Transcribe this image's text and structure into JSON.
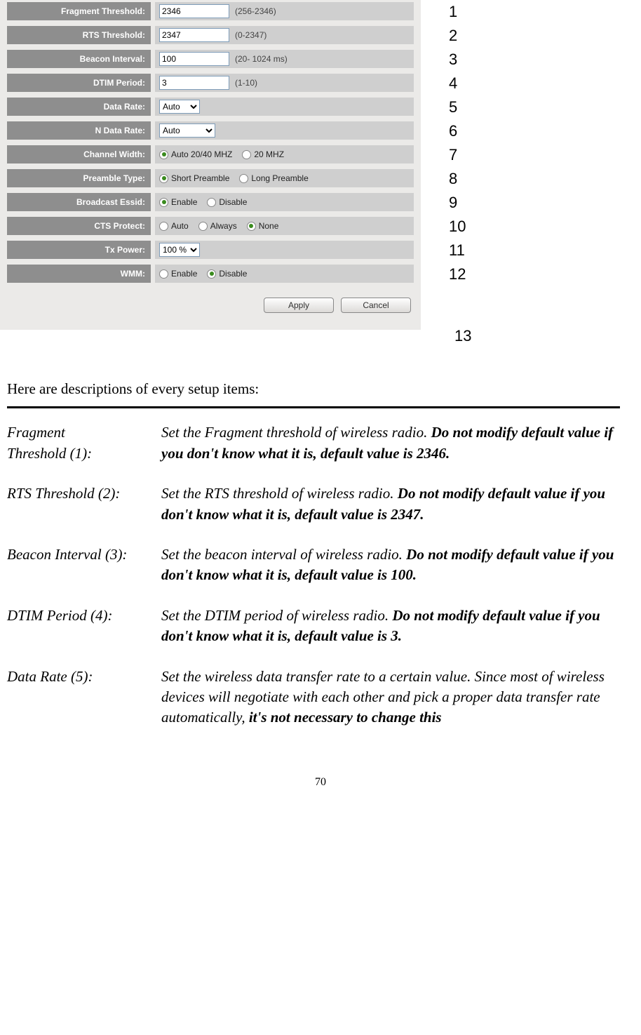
{
  "form": {
    "rows": [
      {
        "label": "Fragment Threshold:",
        "type": "text",
        "value": "2346",
        "hint": "(256-2346)",
        "num": "1"
      },
      {
        "label": "RTS Threshold:",
        "type": "text",
        "value": "2347",
        "hint": "(0-2347)",
        "num": "2"
      },
      {
        "label": "Beacon Interval:",
        "type": "text",
        "value": "100",
        "hint": "(20- 1024 ms)",
        "num": "3"
      },
      {
        "label": "DTIM Period:",
        "type": "text",
        "value": "3",
        "hint": "(1-10)",
        "num": "4"
      },
      {
        "label": "Data Rate:",
        "type": "select",
        "value": "Auto",
        "num": "5"
      },
      {
        "label": "N Data Rate:",
        "type": "select",
        "value": "Auto",
        "num": "6",
        "wide": true
      },
      {
        "label": "Channel Width:",
        "type": "radio",
        "options": [
          {
            "label": "Auto 20/40 MHZ",
            "checked": true
          },
          {
            "label": "20 MHZ",
            "checked": false
          }
        ],
        "num": "7"
      },
      {
        "label": "Preamble Type:",
        "type": "radio",
        "options": [
          {
            "label": "Short Preamble",
            "checked": true
          },
          {
            "label": "Long Preamble",
            "checked": false
          }
        ],
        "num": "8"
      },
      {
        "label": "Broadcast Essid:",
        "type": "radio",
        "options": [
          {
            "label": "Enable",
            "checked": true
          },
          {
            "label": "Disable",
            "checked": false
          }
        ],
        "num": "9"
      },
      {
        "label": "CTS Protect:",
        "type": "radio",
        "options": [
          {
            "label": "Auto",
            "checked": false
          },
          {
            "label": "Always",
            "checked": false
          },
          {
            "label": "None",
            "checked": true
          }
        ],
        "num": "10"
      },
      {
        "label": "Tx Power:",
        "type": "select",
        "value": "100 %",
        "num": "11"
      },
      {
        "label": "WMM:",
        "type": "radio",
        "options": [
          {
            "label": "Enable",
            "checked": false
          },
          {
            "label": "Disable",
            "checked": true
          }
        ],
        "num": "12"
      }
    ],
    "apply": "Apply",
    "cancel": "Cancel",
    "num13": "13"
  },
  "doc": {
    "intro": "Here are descriptions of every setup items:",
    "items": [
      {
        "label": "Fragment Threshold (1):",
        "plain": "Set the Fragment threshold of wireless radio. ",
        "bold": "Do not modify default value if you don't know what it is, default value is 2346."
      },
      {
        "label": "RTS Threshold (2):",
        "plain": "Set the RTS threshold of wireless radio. ",
        "bold": "Do not modify default value if you don't know what it is, default value is 2347."
      },
      {
        "label": "Beacon Interval (3):",
        "plain": "Set the beacon interval of wireless radio. ",
        "bold": "Do not modify default value if you don't know what it is, default value is 100."
      },
      {
        "label": "DTIM Period (4):",
        "plain": "Set the DTIM period of wireless radio. ",
        "bold": "Do not modify default value if you don't know what it is, default value is 3."
      },
      {
        "label": "Data Rate (5):",
        "plain": "Set the wireless data transfer rate to a certain value. Since most of wireless devices will negotiate with each other and pick a proper data transfer rate automatically, ",
        "bold": "it's not necessary to change this"
      }
    ],
    "page": "70"
  }
}
